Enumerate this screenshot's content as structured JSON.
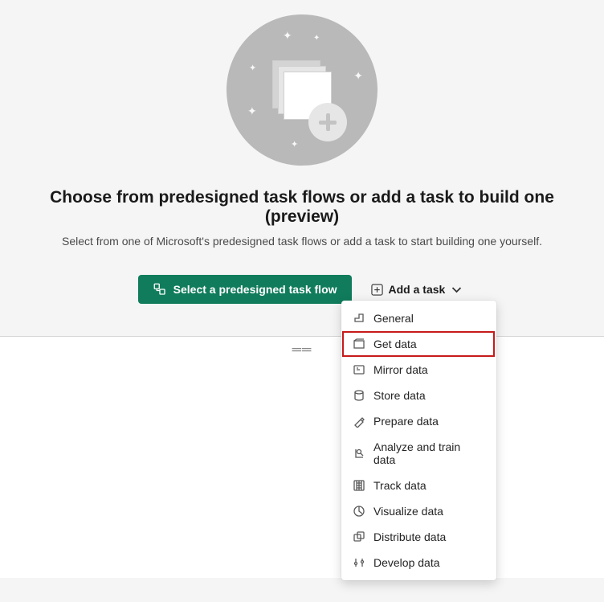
{
  "heading": "Choose from predesigned task flows or add a task to build one (preview)",
  "subheading": "Select from one of Microsoft's predesigned task flows or add a task to start building one yourself.",
  "buttons": {
    "primary": "Select a predesigned task flow",
    "secondary": "Add a task"
  },
  "menu": {
    "items": [
      {
        "label": "General"
      },
      {
        "label": "Get data"
      },
      {
        "label": "Mirror data"
      },
      {
        "label": "Store data"
      },
      {
        "label": "Prepare data"
      },
      {
        "label": "Analyze and train data"
      },
      {
        "label": "Track data"
      },
      {
        "label": "Visualize data"
      },
      {
        "label": "Distribute data"
      },
      {
        "label": "Develop data"
      }
    ],
    "highlighted_index": 1
  }
}
